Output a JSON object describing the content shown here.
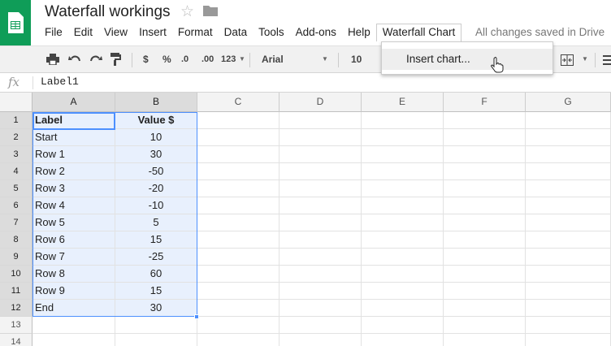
{
  "app": {
    "brand_color": "#0f9d58",
    "accent_color": "#4d90fe"
  },
  "document": {
    "title": "Waterfall workings",
    "star_icon": "star-icon",
    "folder_icon": "folder-icon"
  },
  "menu": {
    "items": [
      "File",
      "Edit",
      "View",
      "Insert",
      "Format",
      "Data",
      "Tools",
      "Add-ons",
      "Help"
    ],
    "active": "Waterfall Chart",
    "save_status": "All changes saved in Drive"
  },
  "toolbar": {
    "currency": "$",
    "percent": "%",
    "dec_decrease": ".0",
    "dec_increase": ".00",
    "more_formats": "123",
    "font": "Arial",
    "font_size": "10"
  },
  "dropdown": {
    "item": "Insert chart..."
  },
  "formula_bar": {
    "fx": "fx",
    "value": "Label1"
  },
  "grid": {
    "columns": [
      "A",
      "B",
      "C",
      "D",
      "E",
      "F",
      "G"
    ],
    "rows": [
      "1",
      "2",
      "3",
      "4",
      "5",
      "6",
      "7",
      "8",
      "9",
      "10",
      "11",
      "12",
      "13",
      "14"
    ],
    "data": [
      [
        "Label",
        "Value $"
      ],
      [
        "Start",
        "10"
      ],
      [
        "Row 1",
        "30"
      ],
      [
        "Row 2",
        "-50"
      ],
      [
        "Row 3",
        "-20"
      ],
      [
        "Row 4",
        "-10"
      ],
      [
        "Row 5",
        "5"
      ],
      [
        "Row 6",
        "15"
      ],
      [
        "Row 7",
        "-25"
      ],
      [
        "Row 8",
        "60"
      ],
      [
        "Row 9",
        "15"
      ],
      [
        "End",
        "30"
      ],
      [
        "",
        ""
      ],
      [
        "",
        ""
      ]
    ]
  }
}
